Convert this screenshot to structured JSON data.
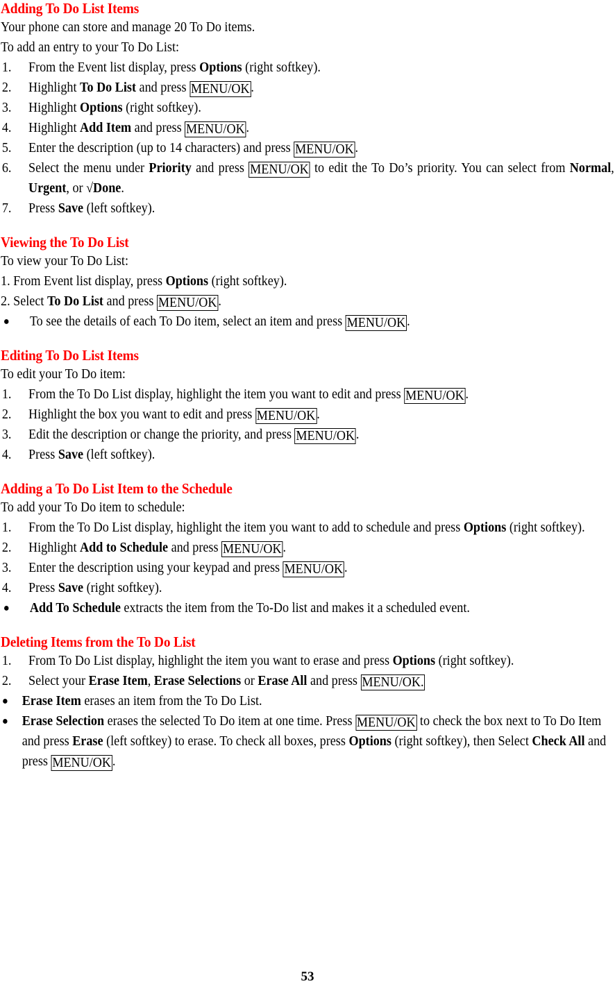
{
  "document": {
    "page_number": "53",
    "heading_color": "#FF0000",
    "text_color": "#000000",
    "background_color": "#FFFFFF"
  },
  "sections": [
    {
      "id": "adding-items",
      "heading": "Adding To Do List Items",
      "intro1": "Your phone can store and manage 20 To Do items.",
      "intro2": "To add an entry to your To Do List:",
      "steps": [
        {
          "num": "1.",
          "parts": [
            {
              "t": "From the Event list display, press ",
              "s": "n"
            },
            {
              "t": "Options",
              "s": "b"
            },
            {
              "t": " (right softkey).",
              "s": "n"
            }
          ]
        },
        {
          "num": "2.",
          "parts": [
            {
              "t": "Highlight ",
              "s": "n"
            },
            {
              "t": "To Do List",
              "s": "b"
            },
            {
              "t": " and press ",
              "s": "n"
            },
            {
              "t": "MENU/OK",
              "s": "k"
            },
            {
              "t": ".",
              "s": "n"
            }
          ]
        },
        {
          "num": "3.",
          "parts": [
            {
              "t": "Highlight ",
              "s": "n"
            },
            {
              "t": "Options",
              "s": "b"
            },
            {
              "t": " (right softkey).",
              "s": "n"
            }
          ]
        },
        {
          "num": "4.",
          "parts": [
            {
              "t": "Highlight ",
              "s": "n"
            },
            {
              "t": "Add Item",
              "s": "b"
            },
            {
              "t": " and press ",
              "s": "n"
            },
            {
              "t": "MENU/OK",
              "s": "k"
            },
            {
              "t": ".",
              "s": "n"
            }
          ]
        },
        {
          "num": "5.",
          "parts": [
            {
              "t": "Enter the description (up to 14 characters) and press ",
              "s": "n"
            },
            {
              "t": "MENU/OK",
              "s": "k"
            },
            {
              "t": ".",
              "s": "n"
            }
          ]
        },
        {
          "num": "6.",
          "justify": true,
          "parts": [
            {
              "t": "Select the menu under ",
              "s": "n"
            },
            {
              "t": "Priority",
              "s": "b"
            },
            {
              "t": " and press ",
              "s": "n"
            },
            {
              "t": "MENU/OK",
              "s": "k"
            },
            {
              "t": " to edit the To Do’s priority. You can select from ",
              "s": "n"
            },
            {
              "t": "Normal",
              "s": "b"
            },
            {
              "t": ", ",
              "s": "n"
            },
            {
              "t": "Urgent",
              "s": "b"
            },
            {
              "t": ", or ",
              "s": "n"
            },
            {
              "t": "√Done",
              "s": "b"
            },
            {
              "t": ".",
              "s": "n"
            }
          ]
        },
        {
          "num": "7.",
          "parts": [
            {
              "t": "Press ",
              "s": "n"
            },
            {
              "t": "Save",
              "s": "b"
            },
            {
              "t": " (left softkey).",
              "s": "n"
            }
          ]
        }
      ]
    },
    {
      "id": "viewing-list",
      "heading": "Viewing the To Do List",
      "intro1": "To view your To Do List:",
      "inline_steps": [
        {
          "parts": [
            {
              "t": "1. From Event list display, press ",
              "s": "n"
            },
            {
              "t": "Options",
              "s": "b"
            },
            {
              "t": " (right softkey).",
              "s": "n"
            }
          ]
        },
        {
          "parts": [
            {
              "t": "2. Select ",
              "s": "n"
            },
            {
              "t": "To Do List",
              "s": "b"
            },
            {
              "t": " and press ",
              "s": "n"
            },
            {
              "t": "MENU/OK",
              "s": "k"
            },
            {
              "t": ".",
              "s": "n"
            }
          ]
        }
      ],
      "bullets": [
        {
          "parts": [
            {
              "t": " To see the details of each To Do item, select an item and press ",
              "s": "n"
            },
            {
              "t": "MENU/OK",
              "s": "k"
            },
            {
              "t": ".",
              "s": "n"
            }
          ]
        }
      ]
    },
    {
      "id": "editing-items",
      "heading": "Editing To Do List Items",
      "intro1": "To edit your To Do item:",
      "steps": [
        {
          "num": "1.",
          "parts": [
            {
              "t": "From the To Do List display, highlight the item you want to edit and press ",
              "s": "n"
            },
            {
              "t": "MENU/OK",
              "s": "k"
            },
            {
              "t": ".",
              "s": "n"
            }
          ]
        },
        {
          "num": "2.",
          "parts": [
            {
              "t": "Highlight the box you want to edit and press ",
              "s": "n"
            },
            {
              "t": "MENU/OK",
              "s": "k"
            },
            {
              "t": ".",
              "s": "n"
            }
          ]
        },
        {
          "num": "3.",
          "parts": [
            {
              "t": "Edit the description or change the priority, and press ",
              "s": "n"
            },
            {
              "t": "MENU/OK",
              "s": "k"
            },
            {
              "t": ".",
              "s": "n"
            }
          ]
        },
        {
          "num": "4.",
          "parts": [
            {
              "t": "Press ",
              "s": "n"
            },
            {
              "t": "Save",
              "s": "b"
            },
            {
              "t": " (left softkey).",
              "s": "n"
            }
          ]
        }
      ]
    },
    {
      "id": "adding-to-schedule",
      "heading": "Adding a To Do List Item to the Schedule",
      "intro1": "To add your To Do item to schedule:",
      "steps": [
        {
          "num": "1.",
          "justify": true,
          "parts": [
            {
              "t": "From the To Do List display, highlight the item you want to add to schedule and press ",
              "s": "n"
            },
            {
              "t": "Options",
              "s": "b"
            },
            {
              "t": " (right softkey).",
              "s": "n"
            }
          ]
        },
        {
          "num": "2.",
          "parts": [
            {
              "t": "Highlight ",
              "s": "n"
            },
            {
              "t": "Add to Schedule",
              "s": "b"
            },
            {
              "t": " and press ",
              "s": "n"
            },
            {
              "t": "MENU/OK",
              "s": "k"
            },
            {
              "t": ".",
              "s": "n"
            }
          ]
        },
        {
          "num": "3.",
          "parts": [
            {
              "t": "Enter the description using your keypad and press ",
              "s": "n"
            },
            {
              "t": "MENU/OK",
              "s": "k"
            },
            {
              "t": ".",
              "s": "n"
            }
          ]
        },
        {
          "num": "4.",
          "parts": [
            {
              "t": "Press ",
              "s": "n"
            },
            {
              "t": "Save",
              "s": "b"
            },
            {
              "t": " (right softkey).",
              "s": "n"
            }
          ]
        }
      ],
      "bullets": [
        {
          "parts": [
            {
              "t": " Add To Schedule",
              "s": "b"
            },
            {
              "t": " extracts the item from the To-Do list and makes it a scheduled event.",
              "s": "n"
            }
          ]
        }
      ]
    },
    {
      "id": "deleting-items",
      "heading": "Deleting Items from the To Do List",
      "steps": [
        {
          "num": "1.",
          "parts": [
            {
              "t": "From To Do List display, highlight the item you want to erase and press ",
              "s": "n"
            },
            {
              "t": "Options",
              "s": "b"
            },
            {
              "t": " (right softkey).",
              "s": "n"
            }
          ]
        },
        {
          "num": "2.",
          "parts": [
            {
              "t": "Select your ",
              "s": "n"
            },
            {
              "t": "Erase Item",
              "s": "b"
            },
            {
              "t": ", ",
              "s": "n"
            },
            {
              "t": "Erase Selections",
              "s": "b"
            },
            {
              "t": " or ",
              "s": "n"
            },
            {
              "t": "Erase All",
              "s": "b"
            },
            {
              "t": " and press ",
              "s": "n"
            },
            {
              "t": "MENU/OK.",
              "s": "k"
            }
          ]
        }
      ],
      "bullets": [
        {
          "parts": [
            {
              "t": "Erase Item",
              "s": "b"
            },
            {
              "t": " erases an item from the To Do List.",
              "s": "n"
            }
          ]
        },
        {
          "parts": [
            {
              "t": "Erase Selection",
              "s": "b"
            },
            {
              "t": " erases the selected To Do item at one time. Press ",
              "s": "n"
            },
            {
              "t": "MENU/OK",
              "s": "k"
            },
            {
              "t": " to check the box next to To Do Item and press ",
              "s": "n"
            },
            {
              "t": "Erase",
              "s": "b"
            },
            {
              "t": " (left softkey) to erase. To check all boxes, press ",
              "s": "n"
            },
            {
              "t": "Options",
              "s": "b"
            },
            {
              "t": " (right softkey), then Select ",
              "s": "n"
            },
            {
              "t": "Check All",
              "s": "b"
            },
            {
              "t": " and press ",
              "s": "n"
            },
            {
              "t": "MENU/OK",
              "s": "k"
            },
            {
              "t": ".",
              "s": "n"
            }
          ]
        }
      ]
    }
  ]
}
